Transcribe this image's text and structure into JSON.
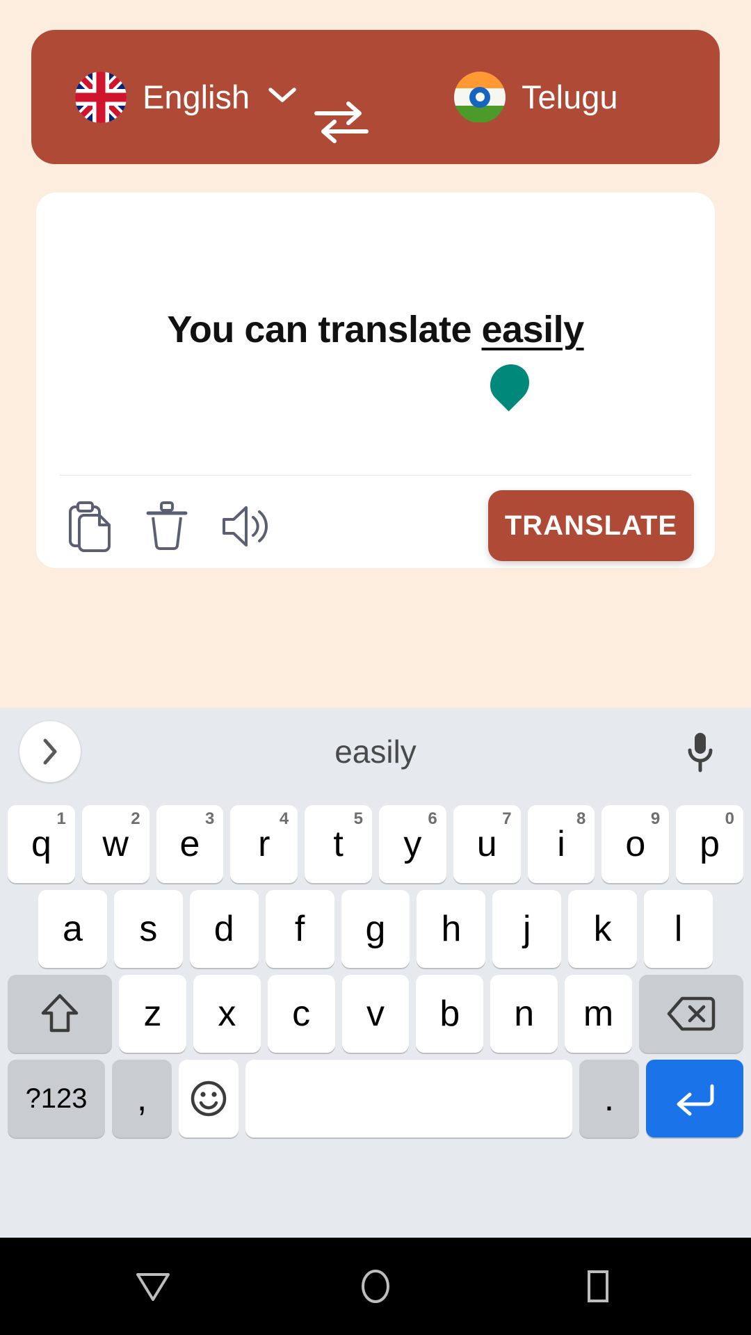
{
  "theme": {
    "page_bg": "#FCEDDF",
    "accent": "#AE4A35",
    "card_bg": "#FFFFFF",
    "cursor_handle": "#00897B",
    "keyboard_bg": "#E6E9ED",
    "key_bg": "#FFFFFF",
    "key_gray": "#C9CDD2",
    "enter_blue": "#1A73E8",
    "navbar_bg": "#000000"
  },
  "language_bar": {
    "source": {
      "name": "English",
      "flag": "uk-flag-icon",
      "caret": "chevron-down-icon"
    },
    "swap": {
      "icon": "swap-arrows-icon"
    },
    "target": {
      "name": "Telugu",
      "flag": "india-flag-icon",
      "caret": "chevron-down-icon"
    }
  },
  "card": {
    "input_text_prefix": "You can translate ",
    "input_text_underlined": "easily",
    "cursor_handle_icon": "text-cursor-handle",
    "actions": {
      "copy": {
        "icon": "copy-icon",
        "label": "Copy"
      },
      "delete": {
        "icon": "trash-icon",
        "label": "Delete"
      },
      "speak": {
        "icon": "speaker-icon",
        "label": "Speak"
      },
      "translate_label": "TRANSLATE"
    }
  },
  "keyboard": {
    "suggestion_bar": {
      "expand_icon": "chevron-right-icon",
      "suggestion": "easily",
      "mic_icon": "microphone-icon"
    },
    "row1": [
      {
        "label": "q",
        "num": "1"
      },
      {
        "label": "w",
        "num": "2"
      },
      {
        "label": "e",
        "num": "3"
      },
      {
        "label": "r",
        "num": "4"
      },
      {
        "label": "t",
        "num": "5"
      },
      {
        "label": "y",
        "num": "6"
      },
      {
        "label": "u",
        "num": "7"
      },
      {
        "label": "i",
        "num": "8"
      },
      {
        "label": "o",
        "num": "9"
      },
      {
        "label": "p",
        "num": "0"
      }
    ],
    "row2": [
      {
        "label": "a"
      },
      {
        "label": "s"
      },
      {
        "label": "d"
      },
      {
        "label": "f"
      },
      {
        "label": "g"
      },
      {
        "label": "h"
      },
      {
        "label": "j"
      },
      {
        "label": "k"
      },
      {
        "label": "l"
      }
    ],
    "row3": {
      "shift": {
        "icon": "shift-icon"
      },
      "keys": [
        {
          "label": "z"
        },
        {
          "label": "x"
        },
        {
          "label": "c"
        },
        {
          "label": "v"
        },
        {
          "label": "b"
        },
        {
          "label": "n"
        },
        {
          "label": "m"
        }
      ],
      "backspace": {
        "icon": "backspace-icon"
      }
    },
    "row4": {
      "symbols": {
        "label": "?123"
      },
      "comma": {
        "label": ","
      },
      "emoji": {
        "icon": "emoji-smiley-icon"
      },
      "space": {
        "label": ""
      },
      "period": {
        "label": "."
      },
      "enter": {
        "icon": "enter-icon"
      }
    }
  },
  "navbar": {
    "back": {
      "icon": "back-triangle-icon"
    },
    "home": {
      "icon": "home-circle-icon"
    },
    "recent": {
      "icon": "recents-square-icon"
    }
  }
}
